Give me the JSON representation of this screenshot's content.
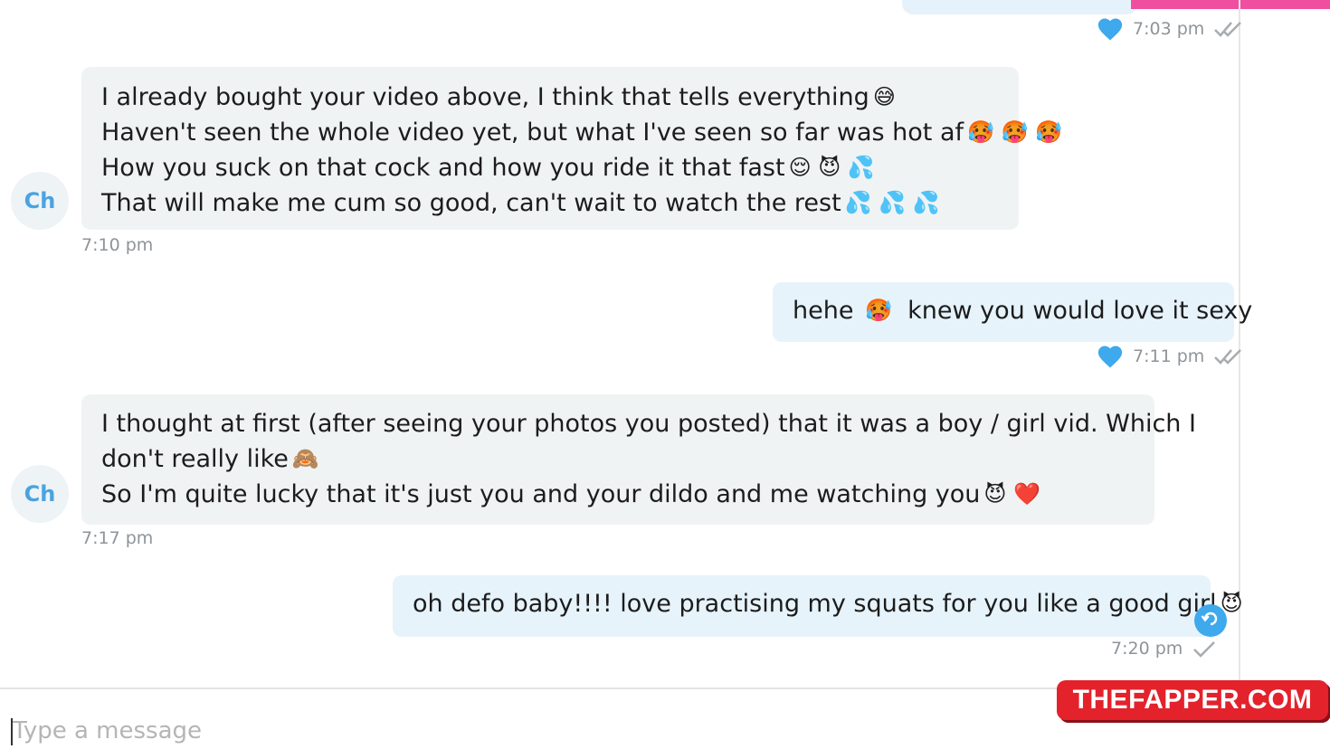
{
  "messages": [
    {
      "sender": "Ch",
      "time": "7:10 pm",
      "lines": [
        {
          "text": "I already bought your video above, I think that tells everything",
          "emoji": "😅"
        },
        {
          "text": "Haven't seen the whole video yet, but what I've seen so far was hot af",
          "emoji": "🥵 🥵 🥵"
        },
        {
          "text": "How you suck on that cock and how you ride it that fast",
          "emoji": "😌 😈 💦"
        },
        {
          "text": "That will make me cum so good, can't wait to watch the rest",
          "emoji": "💦 💦 💦"
        }
      ]
    },
    {
      "sender": "me",
      "time": "7:11 pm",
      "lines": [
        {
          "text": "hehe",
          "emoji": "🥵"
        },
        {
          "text": "knew you would love it sexy"
        }
      ]
    },
    {
      "sender": "Ch",
      "time": "7:17 pm",
      "lines": [
        {
          "text": "I thought at first (after seeing your photos you posted) that it was a boy / girl vid. Which I"
        },
        {
          "text": "don't really like",
          "emoji": "🙈"
        },
        {
          "text": "So I'm quite lucky that it's just you and your dildo and me watching you",
          "emoji": "😈 ❤️"
        }
      ]
    },
    {
      "sender": "me",
      "time": "7:20 pm",
      "lines": [
        {
          "text": "oh defo baby!!!! love practising my squats for you like a good girl",
          "emoji": "😈"
        }
      ]
    }
  ],
  "top_time": "7:03 pm",
  "avatar_initials": "Ch",
  "composer": {
    "placeholder": "Type a message"
  },
  "watermark": "THEFAPPER.COM",
  "colors": {
    "incoming_bubble": "#f0f3f4",
    "outgoing_bubble": "#e6f3fb",
    "accent": "#3ea9ec",
    "heart": "#3ea9ec",
    "watermark": "#e3222c"
  },
  "icons": [
    "heart-icon",
    "double-check-icon",
    "single-check-icon",
    "reply-icon"
  ]
}
